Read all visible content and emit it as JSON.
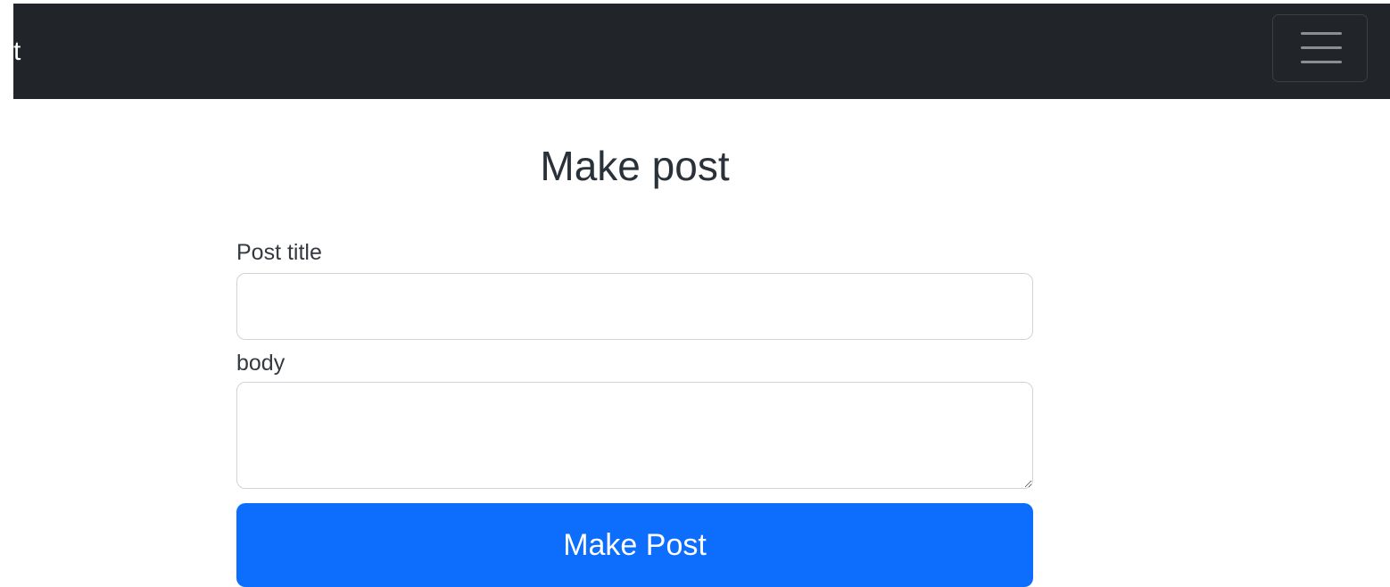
{
  "navbar": {
    "brand_text": "t",
    "toggler_icon": "hamburger-menu-icon",
    "background": "#212529"
  },
  "form": {
    "heading": "Make post",
    "title_label": "Post title",
    "title_value": "",
    "body_label": "body",
    "body_value": "",
    "submit_label": "Make Post",
    "accent_color": "#0d6efd"
  }
}
